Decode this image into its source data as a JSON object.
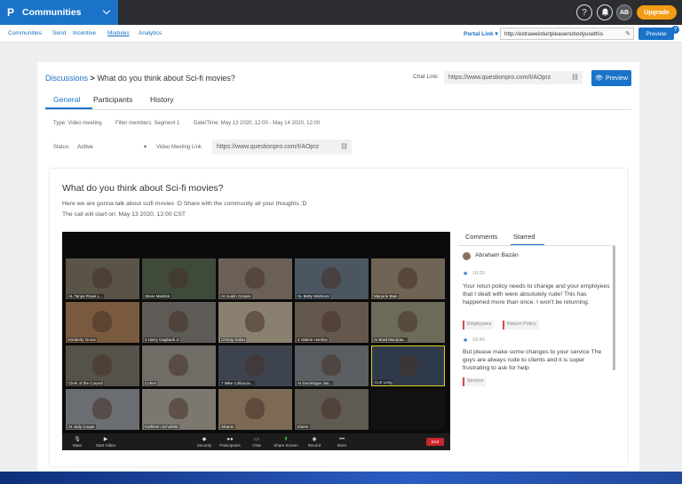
{
  "topbar": {
    "brand_icon": "P",
    "brand": "Communities",
    "help_icon": "?",
    "avatar": "AB",
    "upgrade": "Upgrade",
    "accent": "#1a73c8"
  },
  "subnav": {
    "items": [
      "Communities",
      "Send",
      "Incentive",
      "Modules",
      "Analytics"
    ],
    "active": "Modules",
    "portal_link": "Portal Link",
    "portal_url": "http://extraweirdurlpleasenobodyusethis",
    "preview": "Preview"
  },
  "page": {
    "breadcrumb_link": "Discussions",
    "breadcrumb_sep": ">",
    "title": "What do you think about Sci-fi movies?",
    "chat_link_label": "Chat Link:",
    "chat_link_value": "https://www.questionpro.com/t/AOprz",
    "preview": "Preview",
    "tabs": [
      "General",
      "Participants",
      "History"
    ],
    "active_tab": "General"
  },
  "meta": {
    "type": "Type: Video meeting",
    "filter": "Filter members: Segment 1",
    "datetime": "Date/Time: May 13 2020, 12:00 - May 14 2020, 12:00",
    "status_label": "Status:",
    "status_value": "Active",
    "video_link_label": "Video Meeting Link",
    "video_link_value": "https://www.questionpro.com/t/AOprz"
  },
  "discussion": {
    "title": "What do you think about Sci-fi movies?",
    "description": "Here we are gonna talk about scifi movies :D Share with the community all your thoughts ;D",
    "call_start": "The call will start on: May 13 2020, 12:00 CST"
  },
  "video": {
    "participants": [
      "AL Tanya Rowe L...",
      "Steve Medrick",
      "AI Austin Cesare",
      "AL Betty Walmore",
      "Marjorie Bain",
      "Kimberly Gross",
      "2 Harry Gagliardi Jr",
      "Christy Dolan",
      "4 Valerie Horsley",
      "AI Brad Macdow...",
      "Clerk of the Council",
      "Cohen",
      "7 Mike Colliacon...",
      "AI Dominique Jan...",
      "Curt Leng",
      "AI Jody Coupe",
      "Kathleen Schofield",
      "Sharon",
      "Elaine",
      ""
    ],
    "controls": [
      "Mute",
      "Start Video",
      "Security",
      "Participants",
      "Chat",
      "Share Screen",
      "Record",
      "More"
    ],
    "end": "End"
  },
  "comments": {
    "tabs": [
      "Comments",
      "Starred"
    ],
    "active_tab": "Starred",
    "author": "Abraham Bazán",
    "items": [
      {
        "time": "10:20",
        "text": "Your retun policy needs to change and your employees that I dealt with were absolutely rude! This has happened more than once. I won't be returning.",
        "tags": [
          "Employees",
          "Return Policy"
        ]
      },
      {
        "time": "10:40",
        "text": "But please make some changes to your service The guys are always rude to clients and it is super frustrating to ask for help",
        "tags": [
          "Service"
        ]
      }
    ]
  }
}
